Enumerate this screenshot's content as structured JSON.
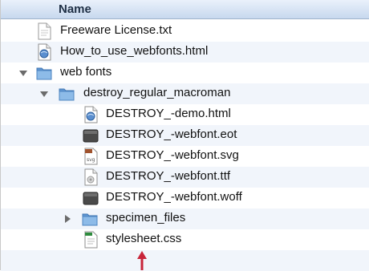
{
  "header": {
    "column_name": "Name"
  },
  "rows": [
    {
      "label": "Freeware License.txt",
      "icon": "text-file-icon"
    },
    {
      "label": "How_to_use_webfonts.html",
      "icon": "html-file-icon"
    },
    {
      "label": "web fonts",
      "icon": "folder-icon",
      "disclosure": "expanded"
    },
    {
      "label": "destroy_regular_macroman",
      "icon": "folder-icon",
      "disclosure": "expanded"
    },
    {
      "label": "DESTROY_-demo.html",
      "icon": "html-file-icon"
    },
    {
      "label": "DESTROY_-webfont.eot",
      "icon": "font-file-icon"
    },
    {
      "label": "DESTROY_-webfont.svg",
      "icon": "svg-file-icon",
      "badge": "svg"
    },
    {
      "label": "DESTROY_-webfont.ttf",
      "icon": "ttf-file-icon"
    },
    {
      "label": "DESTROY_-webfont.woff",
      "icon": "font-file-icon"
    },
    {
      "label": "specimen_files",
      "icon": "folder-icon",
      "disclosure": "collapsed"
    },
    {
      "label": "stylesheet.css",
      "icon": "css-file-icon"
    }
  ],
  "colors": {
    "folder": "#7fb0e0",
    "header_top": "#eaf1fb",
    "header_bottom": "#c7d8ee",
    "arrow": "#c8253a"
  }
}
